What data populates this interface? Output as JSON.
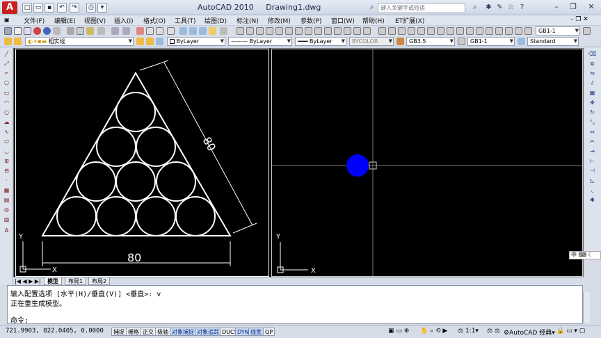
{
  "window": {
    "app_title": "AutoCAD 2010",
    "doc_title": "Drawing1.dwg",
    "search_placeholder": "键入关键字或短语",
    "logo": "A"
  },
  "menu": [
    "文件(F)",
    "编辑(E)",
    "视图(V)",
    "插入(I)",
    "格式(O)",
    "工具(T)",
    "绘图(D)",
    "标注(N)",
    "修改(M)",
    "参数(P)",
    "窗口(W)",
    "帮助(H)",
    "ET扩展(X)"
  ],
  "toolbar": {
    "layer_value": "粗实线",
    "color_value": "ByLayer",
    "linetype_value": "ByLayer",
    "lineweight_value": "ByLayer",
    "plotstyle_value": "BYCOLOR",
    "textstyle_value": "GB3.5",
    "dimstyle_value": "GB1-1",
    "tablestyle_value": "Standard",
    "top_dimstyle_value": "GB1-1"
  },
  "drawing": {
    "dim_bottom": "80",
    "dim_side": "80",
    "ucs_x": "X",
    "ucs_y": "Y",
    "circle_color": "#0000ff",
    "line_color": "#ffffff"
  },
  "tabs": [
    "模型",
    "布局1",
    "布局2"
  ],
  "command": {
    "line1": "输入配置选项 [水平(H)/垂直(V)] <垂直>: v",
    "line2": "正在重生成模型。",
    "prompt": "命令:"
  },
  "status": {
    "coords": "721.9903, 822.0405, 0.0000",
    "buttons": [
      "捕捉",
      "栅格",
      "正交",
      "极轴",
      "对象捕捉",
      "对象追踪",
      "DUCS",
      "DYN",
      "线宽",
      "QP"
    ],
    "scale": "1:1",
    "workspace": "AutoCAD 经典"
  },
  "ime": "中"
}
